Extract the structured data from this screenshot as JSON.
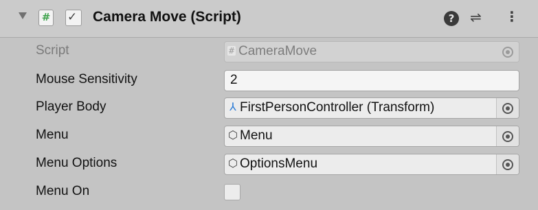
{
  "component": {
    "title": "Camera Move (Script)",
    "script_icon": "#",
    "enabled_check": "✓",
    "help_glyph": "?",
    "presets_glyph": "⇌",
    "menu_glyph": "⋮"
  },
  "properties": [
    {
      "label": "Script",
      "value": "CameraMove",
      "kind": "script-reference",
      "icon": "script-file-icon",
      "icon_glyph": "#",
      "disabled": true
    },
    {
      "label": "Mouse Sensitivity",
      "value": "2",
      "kind": "number"
    },
    {
      "label": "Player Body",
      "value": "FirstPersonController (Transform)",
      "kind": "object-reference",
      "icon": "transform-icon",
      "icon_glyph": "⅄"
    },
    {
      "label": "Menu",
      "value": "Menu",
      "kind": "object-reference",
      "icon": "gameobject-cube-icon",
      "icon_glyph": "⬡"
    },
    {
      "label": "Menu Options",
      "value": "OptionsMenu",
      "kind": "object-reference",
      "icon": "gameobject-cube-icon",
      "icon_glyph": "⬡"
    },
    {
      "label": "Menu On",
      "value": false,
      "kind": "toggle"
    }
  ]
}
